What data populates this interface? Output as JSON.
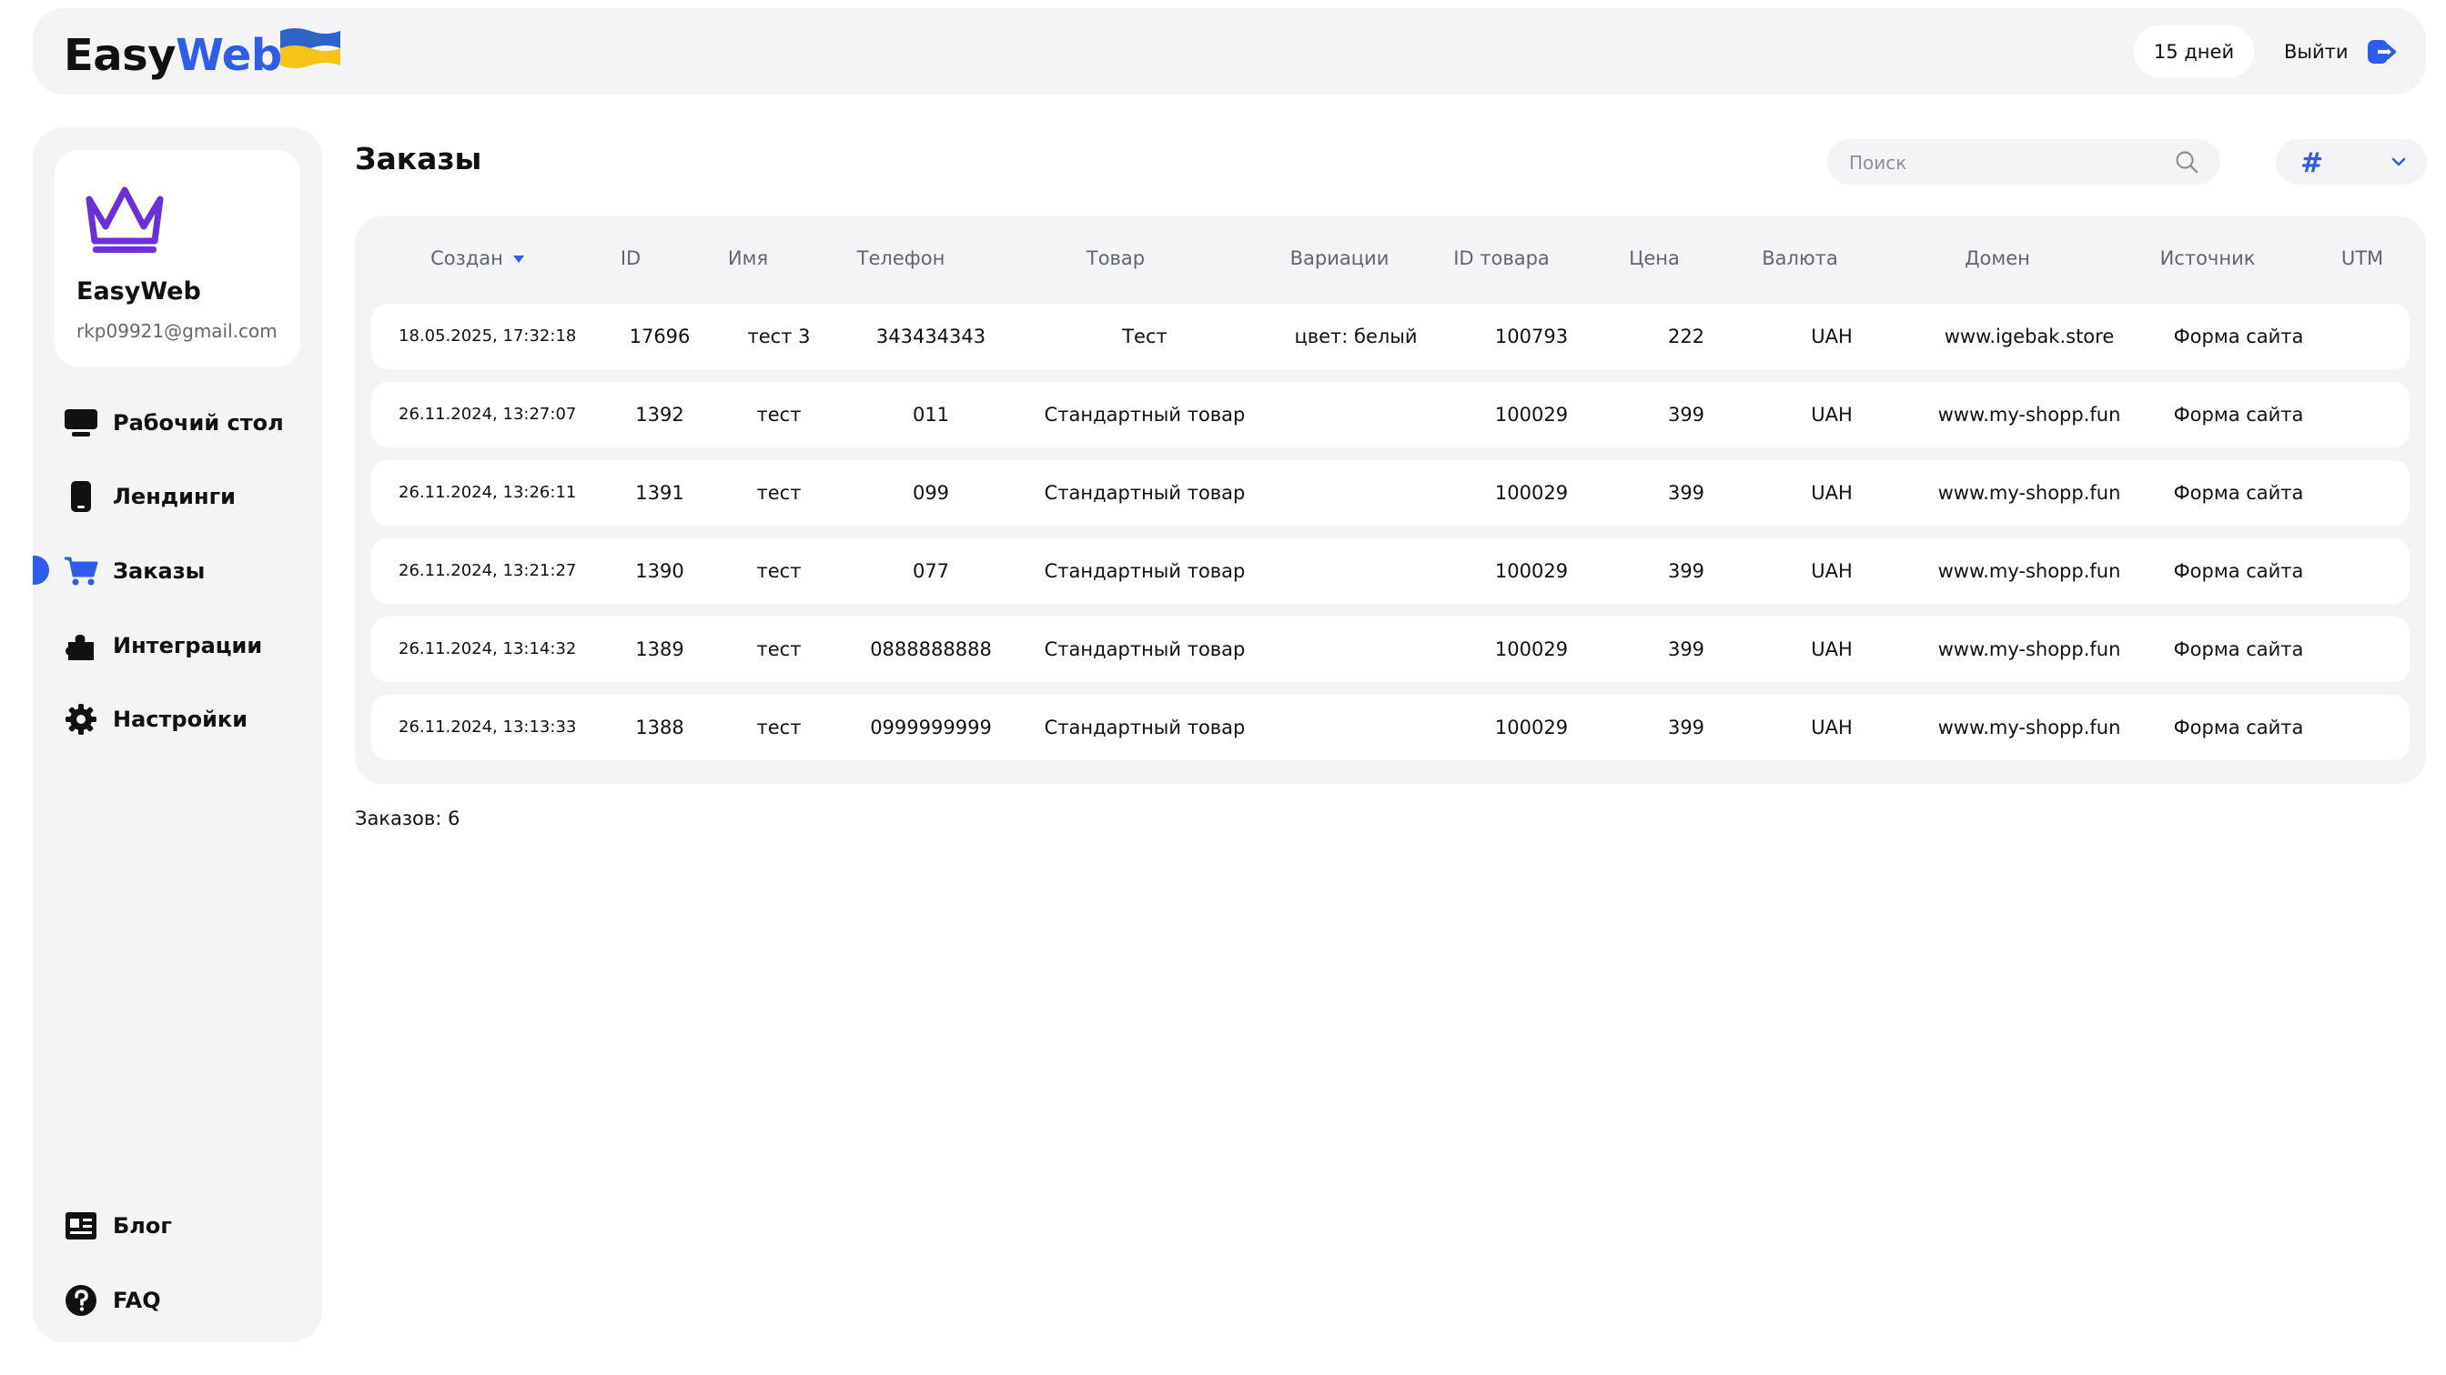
{
  "header": {
    "logo_part1": "Easy",
    "logo_part2": "Web",
    "days_label": "15 дней",
    "logout_label": "Выйти"
  },
  "sidebar": {
    "profile_name": "EasyWeb",
    "profile_email": "rkp09921@gmail.com",
    "items": [
      {
        "label": "Рабочий стол",
        "icon": "monitor-icon"
      },
      {
        "label": "Лендинги",
        "icon": "phone-icon"
      },
      {
        "label": "Заказы",
        "icon": "cart-icon",
        "active": true
      },
      {
        "label": "Интеграции",
        "icon": "puzzle-icon"
      },
      {
        "label": "Настройки",
        "icon": "gear-icon"
      }
    ],
    "bottom_items": [
      {
        "label": "Блог",
        "icon": "newspaper-icon"
      },
      {
        "label": "FAQ",
        "icon": "question-icon"
      }
    ]
  },
  "main": {
    "title": "Заказы",
    "search_placeholder": "Поиск",
    "filter_icon": "hashtag-icon",
    "columns": [
      "Создан",
      "ID",
      "Имя",
      "Телефон",
      "Товар",
      "Вариации",
      "ID товара",
      "Цена",
      "Валюта",
      "Домен",
      "Источник",
      "UTM"
    ],
    "rows": [
      [
        "18.05.2025, 17:32:18",
        "17696",
        "тест 3",
        "343434343",
        "Тест",
        "цвет: белый",
        "100793",
        "222",
        "UAH",
        "www.igebak.store",
        "Форма сайта",
        ""
      ],
      [
        "26.11.2024, 13:27:07",
        "1392",
        "тест",
        "011",
        "Стандартный товар",
        "",
        "100029",
        "399",
        "UAH",
        "www.my-shopp.fun",
        "Форма сайта",
        ""
      ],
      [
        "26.11.2024, 13:26:11",
        "1391",
        "тест",
        "099",
        "Стандартный товар",
        "",
        "100029",
        "399",
        "UAH",
        "www.my-shopp.fun",
        "Форма сайта",
        ""
      ],
      [
        "26.11.2024, 13:21:27",
        "1390",
        "тест",
        "077",
        "Стандартный товар",
        "",
        "100029",
        "399",
        "UAH",
        "www.my-shopp.fun",
        "Форма сайта",
        ""
      ],
      [
        "26.11.2024, 13:14:32",
        "1389",
        "тест",
        "0888888888",
        "Стандартный товар",
        "",
        "100029",
        "399",
        "UAH",
        "www.my-shopp.fun",
        "Форма сайта",
        ""
      ],
      [
        "26.11.2024, 13:13:33",
        "1388",
        "тест",
        "0999999999",
        "Стандартный товар",
        "",
        "100029",
        "399",
        "UAH",
        "www.my-shopp.fun",
        "Форма сайта",
        ""
      ]
    ],
    "orders_count": "Заказов: 6"
  },
  "colors": {
    "accent": "#2f5ce8",
    "brand_crown": "#6a2fd8",
    "panel_bg": "#f4f4f6"
  }
}
